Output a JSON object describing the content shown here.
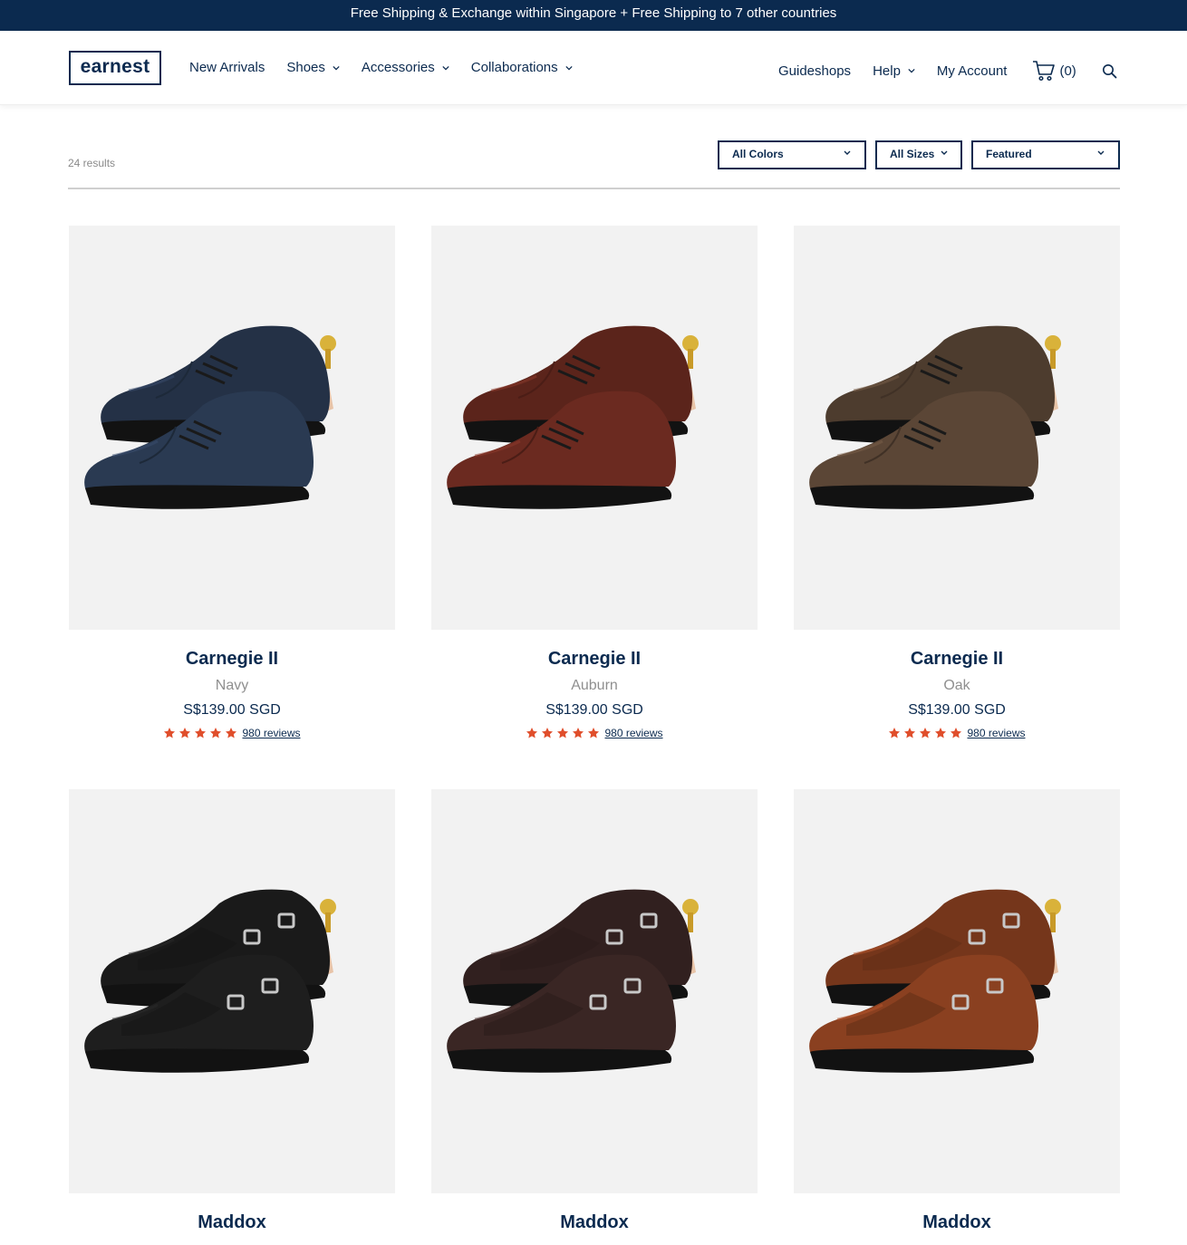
{
  "announcement": "Free Shipping & Exchange within Singapore + Free Shipping to 7 other countries",
  "header": {
    "logo": "earnest",
    "nav_left": [
      {
        "label": "New Arrivals",
        "dropdown": false
      },
      {
        "label": "Shoes",
        "dropdown": true
      },
      {
        "label": "Accessories",
        "dropdown": true
      },
      {
        "label": "Collaborations",
        "dropdown": true
      }
    ],
    "guideshops": "Guideshops",
    "help": "Help",
    "my_account": "My Account",
    "cart_count": "(0)"
  },
  "listing": {
    "results": "24 results",
    "filters": {
      "colors": "All Colors",
      "sizes": "All Sizes",
      "sort": "Featured"
    }
  },
  "products": [
    {
      "name": "Carnegie II",
      "color": "Navy",
      "price": "S$139.00 SGD",
      "rating": 5,
      "reviews": "980 reviews",
      "style": "oxford",
      "shoe_color": "#2a3a52"
    },
    {
      "name": "Carnegie II",
      "color": "Auburn",
      "price": "S$139.00 SGD",
      "rating": 5,
      "reviews": "980 reviews",
      "style": "oxford",
      "shoe_color": "#6b2a20"
    },
    {
      "name": "Carnegie II",
      "color": "Oak",
      "price": "S$139.00 SGD",
      "rating": 5,
      "reviews": "980 reviews",
      "style": "oxford",
      "shoe_color": "#5b4636"
    },
    {
      "name": "Maddox",
      "style": "monk",
      "shoe_color": "#1e1e1e"
    },
    {
      "name": "Maddox",
      "style": "monk",
      "shoe_color": "#3a2624"
    },
    {
      "name": "Maddox",
      "style": "monk",
      "shoe_color": "#8a4020"
    }
  ],
  "colors": {
    "navy": "#0b2a4f",
    "star": "#e04e2b",
    "image_bg": "#f2f2f2"
  }
}
